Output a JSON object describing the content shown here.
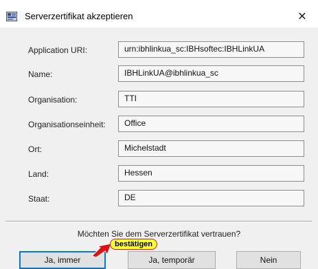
{
  "dialog": {
    "title": "Serverzertifikat akzeptieren",
    "close_glyph": "✕"
  },
  "fields": [
    {
      "label": "Application URI:",
      "value": "urn:ibhlinkua_sc:IBHsoftec:IBHLinkUA"
    },
    {
      "label": "Name:",
      "value": "IBHLinkUA@ibhlinkua_sc"
    },
    {
      "label": "Organisation:",
      "value": "TTI"
    },
    {
      "label": "Organisationseinheit:",
      "value": "Office"
    },
    {
      "label": "Ort:",
      "value": "Michelstadt"
    },
    {
      "label": "Land:",
      "value": "Hessen"
    },
    {
      "label": "Staat:",
      "value": "DE"
    }
  ],
  "question": "Möchten Sie dem Serverzertifikat vertrauen?",
  "buttons": {
    "always": "Ja, immer",
    "temporary": "Ja, temporär",
    "no": "Nein"
  },
  "annotation": {
    "text": "bestätigen",
    "fill_color": "#ffff33",
    "border_color": "#cc2222"
  },
  "colors": {
    "focus_border": "#0078d7",
    "window_bg": "#f0f0f0"
  },
  "icons": {
    "app": "certificate-app-icon",
    "close": "close-icon",
    "arrow": "red-arrow-icon"
  }
}
